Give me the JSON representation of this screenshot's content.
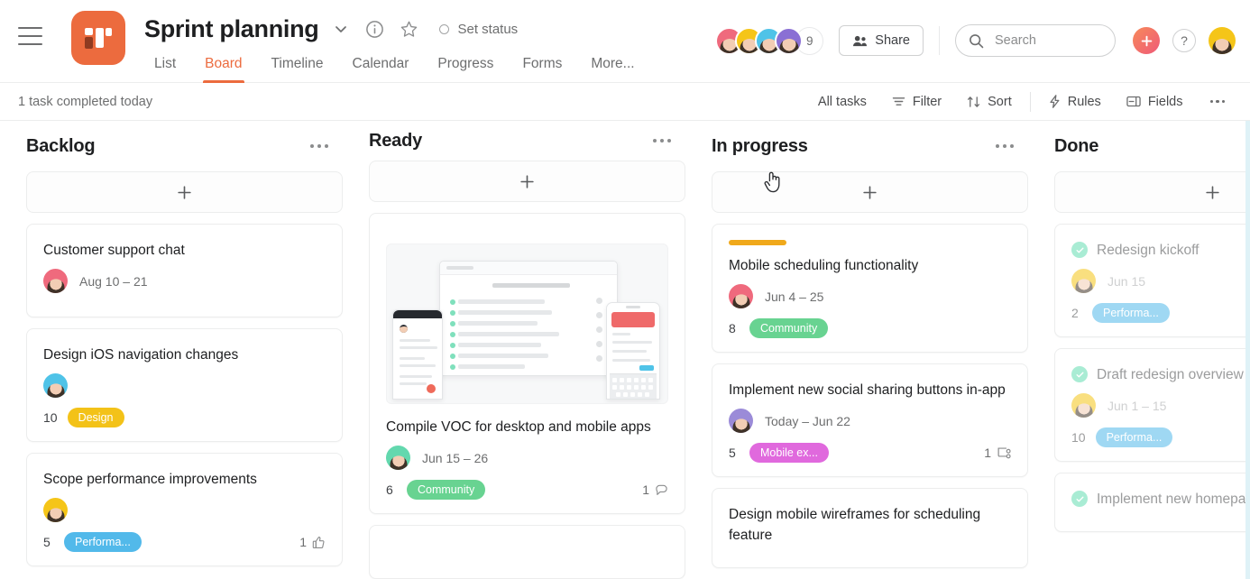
{
  "header": {
    "project_title": "Sprint planning",
    "set_status_label": "Set status",
    "tabs": [
      {
        "label": "List",
        "active": false
      },
      {
        "label": "Board",
        "active": true
      },
      {
        "label": "Timeline",
        "active": false
      },
      {
        "label": "Calendar",
        "active": false
      },
      {
        "label": "Progress",
        "active": false
      },
      {
        "label": "Forms",
        "active": false
      },
      {
        "label": "More...",
        "active": false
      }
    ],
    "member_overflow_count": "9",
    "share_label": "Share",
    "search_placeholder": "Search",
    "help_label": "?",
    "accent_color": "#ec6b3e"
  },
  "toolbar": {
    "status_text": "1 task completed today",
    "all_tasks_label": "All tasks",
    "filter_label": "Filter",
    "sort_label": "Sort",
    "rules_label": "Rules",
    "fields_label": "Fields"
  },
  "board": {
    "columns": [
      {
        "title": "Backlog",
        "cards": [
          {
            "title": "Customer support chat",
            "date": "Aug 10 – 21",
            "avatar_color": "a-pink",
            "points": "",
            "tag": null,
            "tag_color": "",
            "foot_right_count": "",
            "foot_right_icon": ""
          },
          {
            "title": "Design iOS navigation changes",
            "date": "",
            "avatar_color": "a-cyan",
            "points": "10",
            "tag": "Design",
            "tag_color": "#f3c218",
            "foot_right_count": "",
            "foot_right_icon": ""
          },
          {
            "title": "Scope performance improvements",
            "date": "",
            "avatar_color": "a-yellow",
            "points": "5",
            "tag": "Performa...",
            "tag_color": "#52b9ea",
            "foot_right_count": "1",
            "foot_right_icon": "thumbs-up-icon"
          }
        ]
      },
      {
        "title": "Ready",
        "cards": [
          {
            "title": "Compile VOC for desktop and mobile apps",
            "date": "Jun 15 – 26",
            "avatar_color": "a-green",
            "points": "6",
            "tag": "Community",
            "tag_color": "#68d391",
            "foot_right_count": "1",
            "foot_right_icon": "comment-icon",
            "has_image": true
          }
        ]
      },
      {
        "title": "In progress",
        "cards": [
          {
            "title": "Mobile scheduling functionality",
            "date": "Jun 4 – 25",
            "avatar_color": "a-pink",
            "points": "8",
            "tag": "Community",
            "tag_color": "#68d391",
            "foot_right_count": "",
            "foot_right_icon": "",
            "cover_color": "#f0a91b"
          },
          {
            "title": "Implement new social sharing buttons in-app",
            "date": "Today – Jun 22",
            "avatar_color": "a-lilac",
            "points": "5",
            "tag": "Mobile ex...",
            "tag_color": "#e069dd",
            "foot_right_count": "1",
            "foot_right_icon": "subtask-icon"
          },
          {
            "title": "Design mobile wireframes for scheduling feature",
            "date": "",
            "avatar_color": "",
            "points": "",
            "tag": null,
            "tag_color": "",
            "foot_right_count": "",
            "foot_right_icon": ""
          }
        ]
      },
      {
        "title": "Done",
        "cards": [
          {
            "title": "Redesign kickoff",
            "date": "Jun 15",
            "avatar_color": "a-yellow",
            "points": "2",
            "tag": "Performa...",
            "tag_color": "#52b9ea",
            "completed": true
          },
          {
            "title": "Draft redesign overview kickoff meeting",
            "date": "Jun 1 – 15",
            "avatar_color": "a-yellow",
            "points": "10",
            "tag": "Performa...",
            "tag_color": "#52b9ea",
            "completed": true
          },
          {
            "title": "Implement new homepage navigations",
            "date": "",
            "avatar_color": "",
            "points": "",
            "tag": null,
            "tag_color": "",
            "completed": true
          }
        ]
      }
    ]
  }
}
